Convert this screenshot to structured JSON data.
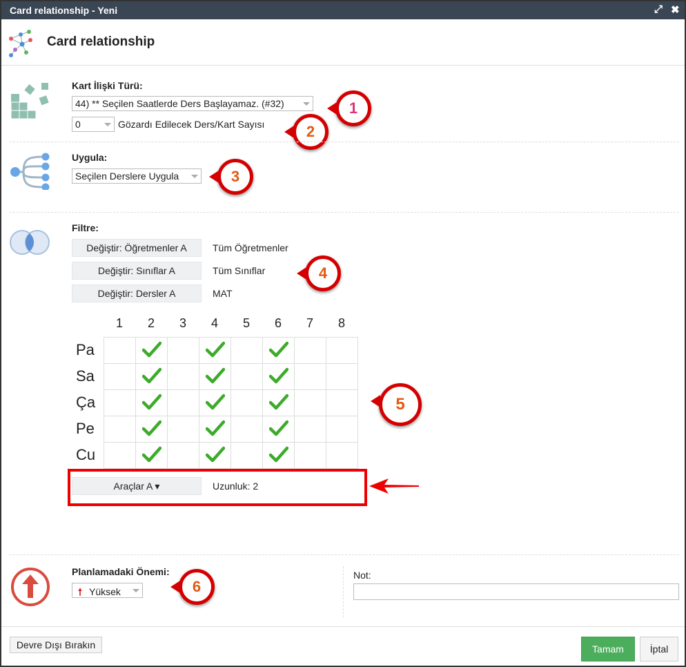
{
  "window": {
    "title": "Card relationship - Yeni",
    "maximize_icon": "⤢",
    "close_icon": "✖"
  },
  "header": {
    "title": "Card relationship"
  },
  "kart": {
    "label": "Kart İlişki Türü:",
    "type_value": "44) ** Seçilen Saatlerde Ders Başlayamaz. (#32)",
    "ignore_value": "0",
    "ignore_label": "Gözardı Edilecek Ders/Kart Sayısı"
  },
  "apply": {
    "label": "Uygula:",
    "value": "Seçilen Derslere Uygula"
  },
  "filter": {
    "label": "Filtre:",
    "rows": [
      {
        "button": "Değiştir: Öğretmenler A",
        "value": "Tüm Öğretmenler"
      },
      {
        "button": "Değiştir: Sınıflar A",
        "value": "Tüm Sınıflar"
      },
      {
        "button": "Değiştir: Dersler A",
        "value": "MAT"
      }
    ]
  },
  "grid": {
    "columns": [
      "1",
      "2",
      "3",
      "4",
      "5",
      "6",
      "7",
      "8"
    ],
    "rows": [
      "Pa",
      "Sa",
      "Ça",
      "Pe",
      "Cu"
    ],
    "checked_columns": [
      2,
      4,
      6
    ]
  },
  "tools": {
    "button": "Araçlar A ▾",
    "length": "Uzunluk: 2"
  },
  "importance": {
    "label": "Planlamadaki Önemi:",
    "value": "Yüksek"
  },
  "note": {
    "label": "Not:",
    "value": ""
  },
  "footer": {
    "disable": "Devre Dışı Bırakın",
    "ok": "Tamam",
    "cancel": "İptal"
  },
  "callouts": [
    "1",
    "2",
    "3",
    "4",
    "5",
    "6"
  ],
  "colors": {
    "titlebar": "#3b4654",
    "callout": "#d40000",
    "check": "#3cab2a",
    "ok_button": "#4cae5c"
  }
}
